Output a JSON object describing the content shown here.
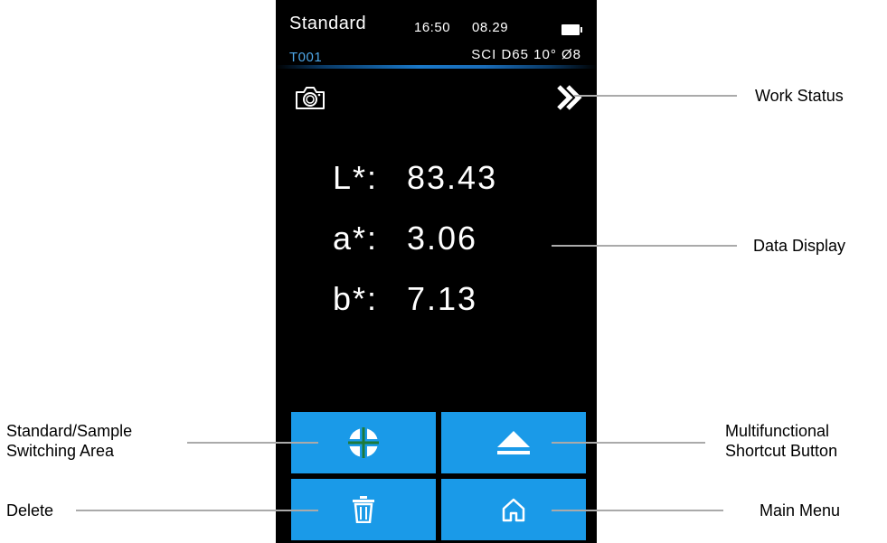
{
  "device": {
    "status": {
      "title": "Standard",
      "time": "16:50",
      "date": "08.29",
      "record_id": "T001",
      "conditions": "SCI D65 10° Ø8"
    },
    "icons": {
      "camera": "camera-icon",
      "work_status": "double-chevron-right-icon"
    },
    "readings": [
      {
        "label": "L*:",
        "value": "83.43"
      },
      {
        "label": "a*:",
        "value": "3.06"
      },
      {
        "label": "b*:",
        "value": "7.13"
      }
    ],
    "buttons": {
      "switch": "crosshair-circle-icon",
      "shortcut": "eject-icon",
      "delete": "trash-icon",
      "menu": "home-icon"
    },
    "colors": {
      "accent": "#1a9ae8",
      "record_id": "#4ea7e8"
    }
  },
  "callouts": {
    "work_status": "Work Status",
    "data_display": "Data Display",
    "standard_sample_line1": "Standard/Sample",
    "standard_sample_line2": "Switching Area",
    "multifunctional_line1": "Multifunctional",
    "multifunctional_line2": "Shortcut Button",
    "delete": "Delete",
    "main_menu": "Main Menu"
  }
}
